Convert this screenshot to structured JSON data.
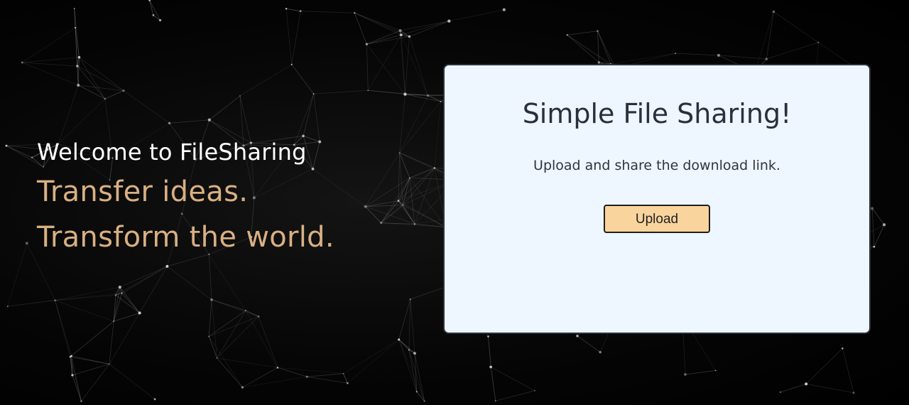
{
  "hero": {
    "welcome": "Welcome to FileSharing",
    "tagline_line1": "Transfer ideas.",
    "tagline_line2": "Transform the world."
  },
  "card": {
    "title": "Simple File Sharing!",
    "subtitle": "Upload and share the download link.",
    "upload_label": "Upload"
  },
  "colors": {
    "background": "#000000",
    "welcome_text": "#ffffff",
    "tagline_text": "#d9b083",
    "card_background": "#eef6ff",
    "card_border": "#2c3140",
    "button_background": "#fad49d"
  }
}
